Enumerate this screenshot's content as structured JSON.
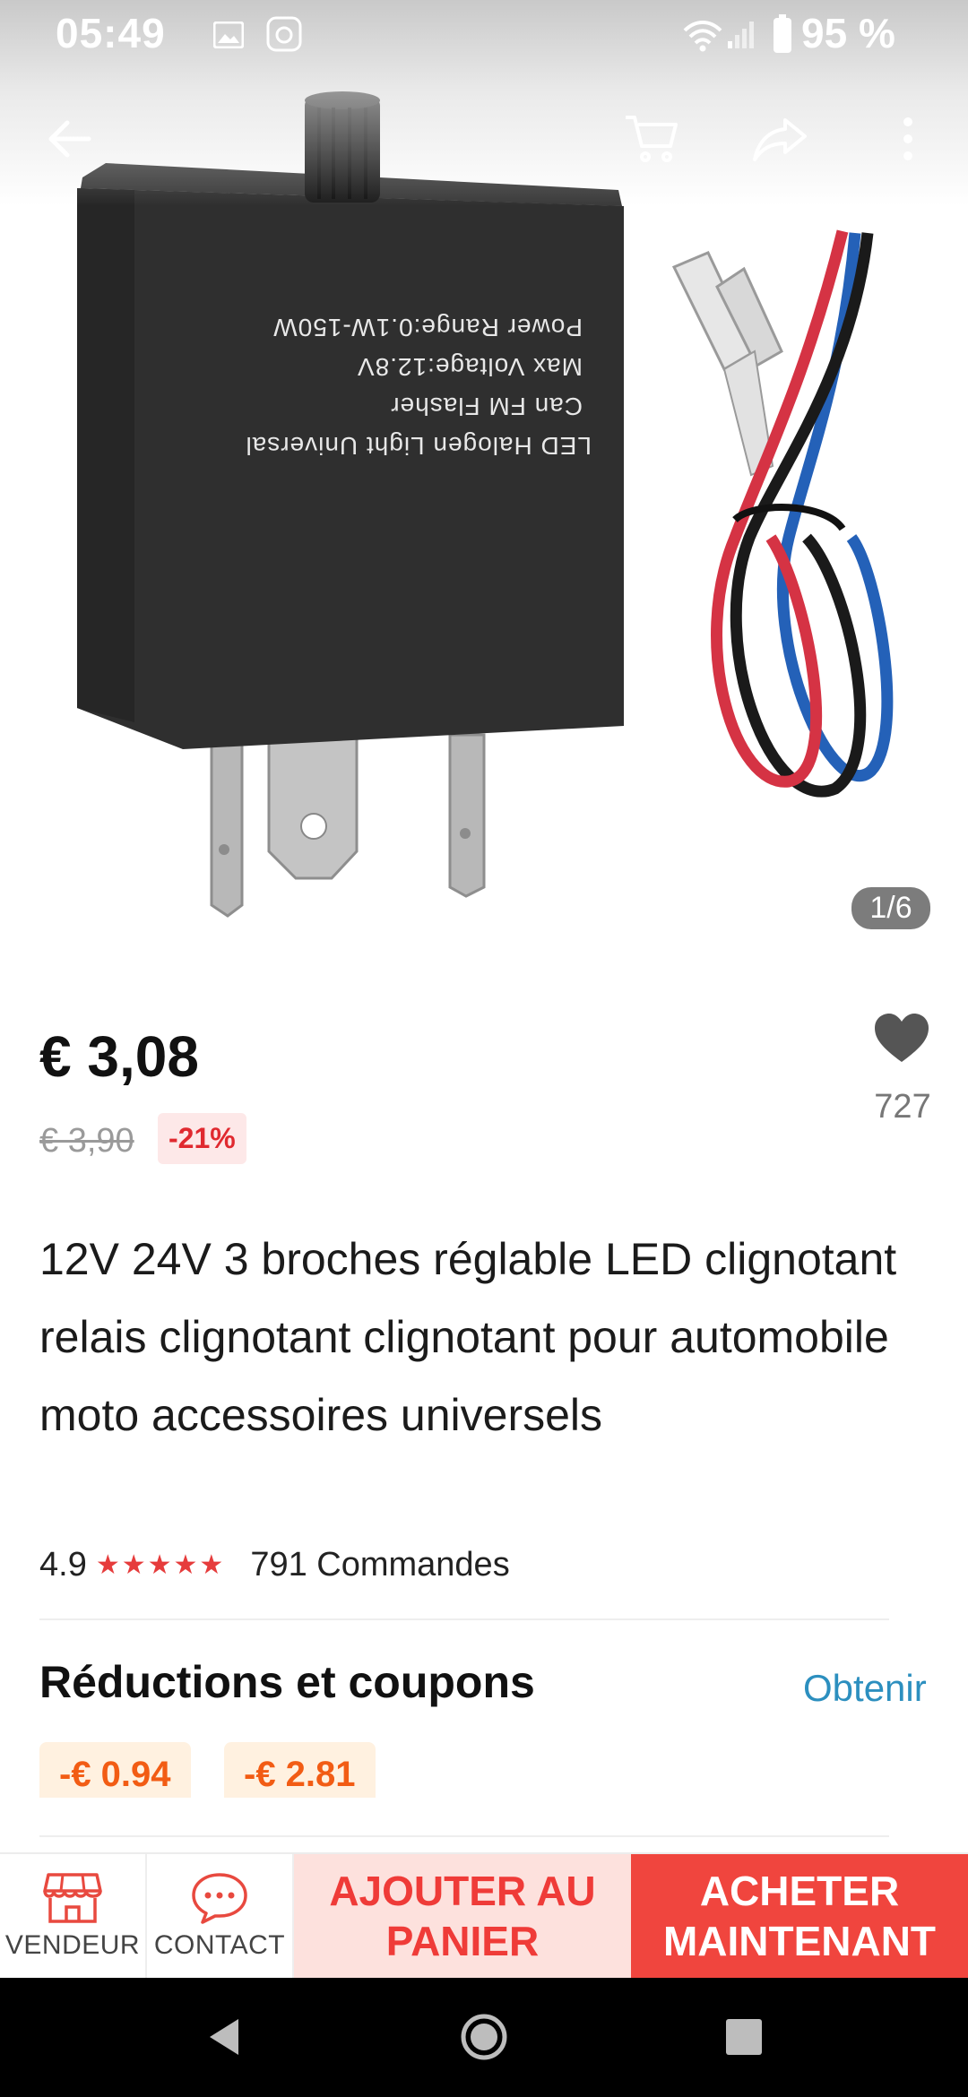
{
  "status_bar": {
    "time": "05:49",
    "battery": "95 %"
  },
  "gallery": {
    "counter": "1/6",
    "product_print": [
      "LED Halogen Light Universal",
      "Can FM Flasher",
      "Max Voltage:12.8V",
      "Power Range:0.1W-150W"
    ]
  },
  "product": {
    "price": "€ 3,08",
    "original_price": "€ 3,90",
    "discount": "-21%",
    "wishlist_count": "727",
    "title": "12V 24V 3 broches réglable LED clignotant relais clignotant clignotant pour automobile moto accessoires universels",
    "rating": "4.9",
    "stars": "★★★★★",
    "orders": "791 Commandes"
  },
  "coupons": {
    "title": "Réductions et coupons",
    "link": "Obtenir",
    "items": [
      "-€ 0.94",
      "-€ 2.81"
    ]
  },
  "action_bar": {
    "store_label": "VENDEUR",
    "contact_label": "CONTACT",
    "add_to_cart": "AJOUTER AU PANIER",
    "buy_now": "ACHETER MAINTENANT"
  },
  "colors": {
    "accent_red": "#f0453e",
    "link_blue": "#2c8fbf",
    "coupon_orange": "#f25c14"
  },
  "icons": [
    "back-arrow-icon",
    "cart-icon",
    "share-icon",
    "more-vertical-icon",
    "heart-icon",
    "store-icon",
    "chat-icon"
  ]
}
